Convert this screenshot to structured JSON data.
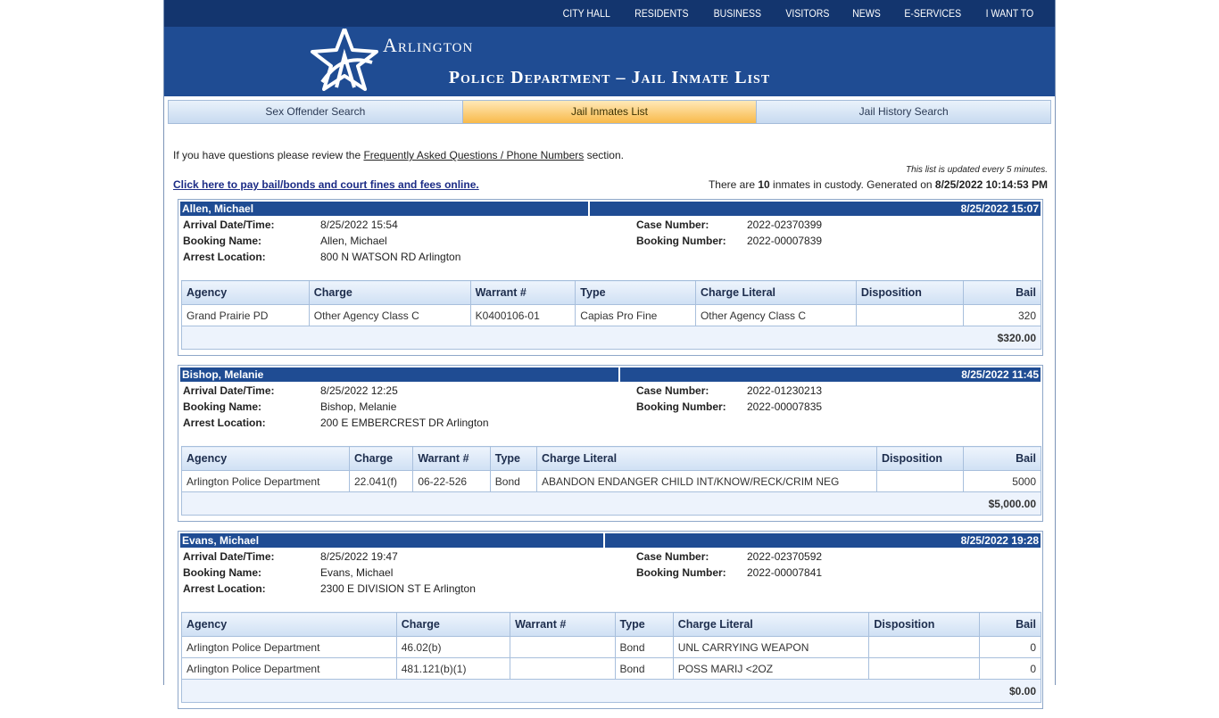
{
  "topnav": [
    "CITY HALL",
    "RESIDENTS",
    "BUSINESS",
    "VISITORS",
    "NEWS",
    "E-SERVICES",
    "I WANT TO"
  ],
  "logo_text": "Arlington",
  "page_title": "Police Department – Jail Inmate List",
  "subtabs": [
    {
      "label": "Sex Offender Search",
      "active": false
    },
    {
      "label": "Jail Inmates List",
      "active": true
    },
    {
      "label": "Jail History Search",
      "active": false
    }
  ],
  "faq": {
    "prefix": "If you have questions please review the ",
    "link": "Frequently Asked Questions / Phone Numbers",
    "suffix": " section."
  },
  "update_note": "This list is updated every 5 minutes.",
  "pay_link": "Click here to pay bail/bonds and court fines and fees online.",
  "custody": {
    "prefix": "There are ",
    "count": "10",
    "middle": " inmates in custody. Generated on ",
    "generated": "8/25/2022 10:14:53 PM"
  },
  "labels": {
    "arrival": "Arrival Date/Time:",
    "booking_name": "Booking Name:",
    "arrest_location": "Arrest Location:",
    "case_number": "Case Number:",
    "booking_number": "Booking Number:"
  },
  "columns": [
    "Agency",
    "Charge",
    "Warrant #",
    "Type",
    "Charge Literal",
    "Disposition",
    "Bail"
  ],
  "inmates": [
    {
      "name": "Allen, Michael",
      "header_date": "8/25/2022 15:07",
      "arrival": "8/25/2022 15:54",
      "booking_name": "Allen, Michael",
      "arrest_location": "800 N WATSON RD Arlington",
      "case_number": "2022-02370399",
      "booking_number": "2022-00007839",
      "charges": [
        [
          "Grand Prairie PD",
          "Other Agency Class C",
          "K0400106-01",
          "Capias Pro Fine",
          "Other Agency Class C",
          "",
          "320"
        ]
      ],
      "total": "$320.00"
    },
    {
      "name": "Bishop, Melanie",
      "header_date": "8/25/2022 11:45",
      "arrival": "8/25/2022 12:25",
      "booking_name": "Bishop, Melanie",
      "arrest_location": "200 E EMBERCREST DR Arlington",
      "case_number": "2022-01230213",
      "booking_number": "2022-00007835",
      "charges": [
        [
          "Arlington Police Department",
          "22.041(f)",
          "06-22-526",
          "Bond",
          "ABANDON ENDANGER CHILD INT/KNOW/RECK/CRIM NEG",
          "",
          "5000"
        ]
      ],
      "total": "$5,000.00"
    },
    {
      "name": "Evans, Michael",
      "header_date": "8/25/2022 19:28",
      "arrival": "8/25/2022 19:47",
      "booking_name": "Evans, Michael",
      "arrest_location": "2300 E DIVISION ST E Arlington",
      "case_number": "2022-02370592",
      "booking_number": "2022-00007841",
      "charges": [
        [
          "Arlington Police Department",
          "46.02(b)",
          "",
          "Bond",
          "UNL CARRYING WEAPON",
          "",
          "0"
        ],
        [
          "Arlington Police Department",
          "481.121(b)(1)",
          "",
          "Bond",
          "POSS MARIJ <2OZ",
          "",
          "0"
        ]
      ],
      "total": "$0.00"
    }
  ]
}
